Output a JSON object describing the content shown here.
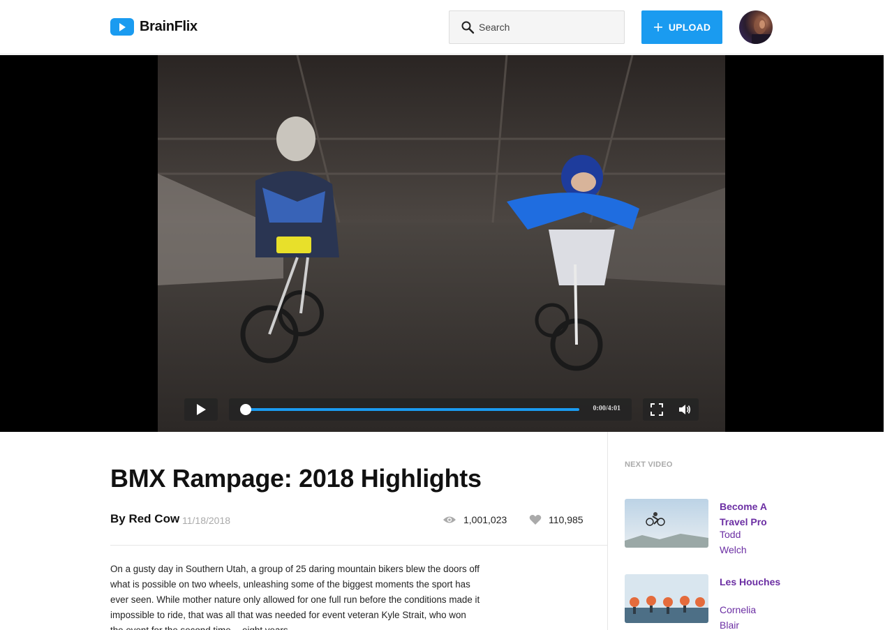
{
  "header": {
    "brand": "BrainFlix",
    "search_placeholder": "Search",
    "upload_label": "UPLOAD"
  },
  "player": {
    "timecode": "0:00/4:01",
    "progress_fraction": 0.0
  },
  "video": {
    "title": "BMX Rampage: 2018 Highlights",
    "byline": "By Red Cow",
    "date": "11/18/2018",
    "views": "1,001,023",
    "likes": "110,985",
    "description": "On a gusty day in Southern Utah, a group of 25 daring mountain bikers blew the doors off what is possible on two wheels, unleashing some of the biggest moments the sport has ever seen. While mother nature only allowed for one full run before the conditions made it impossible to ride, that was all that was needed for event veteran Kyle Strait, who won the event for the second time -- eight years"
  },
  "sidebar": {
    "next_label": "NEXT VIDEO",
    "items": [
      {
        "title": "Become A Travel Pro",
        "author": "Todd Welch"
      },
      {
        "title": "Les Houches",
        "author": "Cornelia Blair"
      }
    ]
  },
  "colors": {
    "accent": "#1a9bf0",
    "link_purple": "#6b2ea3",
    "muted": "#aaaaaa"
  }
}
